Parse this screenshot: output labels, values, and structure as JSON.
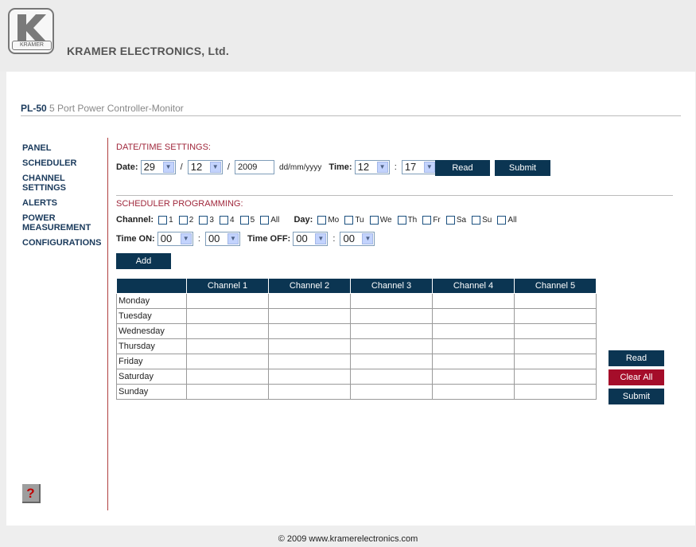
{
  "header": {
    "logo_text": "KRAMER",
    "company": "KRAMER ELECTRONICS, Ltd."
  },
  "product": {
    "model": "PL-50",
    "description": "5 Port Power Controller-Monitor"
  },
  "nav": {
    "items": [
      {
        "label": "PANEL"
      },
      {
        "label": "SCHEDULER"
      },
      {
        "label": "CHANNEL\nSETTINGS"
      },
      {
        "label": "ALERTS"
      },
      {
        "label": "POWER\nMEASUREMENT"
      },
      {
        "label": "CONFIGURATIONS"
      }
    ],
    "help_label": "?"
  },
  "datetime": {
    "title": "DATE/TIME SETTINGS:",
    "date_label": "Date:",
    "day": "29",
    "month": "12",
    "year": "2009",
    "format_hint": "dd/mm/yyyy",
    "time_label": "Time:",
    "hour": "12",
    "minute": "17",
    "slash": "/",
    "colon": ":",
    "read_label": "Read",
    "submit_label": "Submit"
  },
  "scheduler": {
    "title": "SCHEDULER PROGRAMMING:",
    "channel_label": "Channel:",
    "channels": [
      "1",
      "2",
      "3",
      "4",
      "5",
      "All"
    ],
    "day_label": "Day:",
    "days": [
      "Mo",
      "Tu",
      "We",
      "Th",
      "Fr",
      "Sa",
      "Su",
      "All"
    ],
    "time_on_label": "Time ON:",
    "on_hour": "00",
    "on_minute": "00",
    "time_off_label": "Time OFF:",
    "off_hour": "00",
    "off_minute": "00",
    "add_label": "Add"
  },
  "table": {
    "columns": [
      "",
      "Channel 1",
      "Channel 2",
      "Channel 3",
      "Channel 4",
      "Channel 5"
    ],
    "rows": [
      "Monday",
      "Tuesday",
      "Wednesday",
      "Thursday",
      "Friday",
      "Saturday",
      "Sunday"
    ]
  },
  "actions": {
    "read_label": "Read",
    "clear_label": "Clear All",
    "submit_label": "Submit"
  },
  "footer": {
    "text": "© 2009 www.kramerelectronics.com"
  },
  "colors": {
    "navy": "#0b3552",
    "accent_red": "#a50d2a",
    "section_title": "#a0283c"
  }
}
